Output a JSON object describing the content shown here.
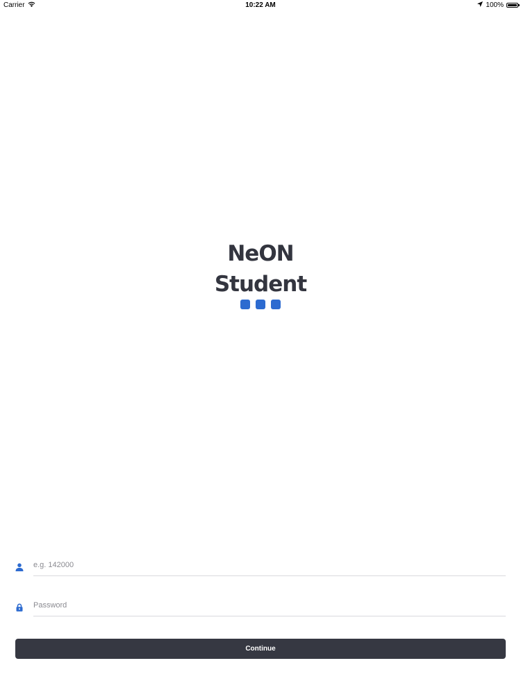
{
  "status_bar": {
    "carrier": "Carrier",
    "time": "10:22 AM",
    "battery": "100%",
    "icons": [
      "wifi-icon",
      "location-arrow-icon",
      "battery-icon"
    ]
  },
  "logo": {
    "line1": "NeON",
    "line2": "Student",
    "dot_color": "#2d6bd0"
  },
  "form": {
    "username_placeholder": "e.g. 142000",
    "password_placeholder": "Password",
    "username_icon": "user-icon",
    "password_icon": "lock-icon",
    "continue_label": "Continue"
  },
  "colors": {
    "accent": "#2d6bd0",
    "button_bg": "#363842",
    "text_dark": "#33353f"
  }
}
